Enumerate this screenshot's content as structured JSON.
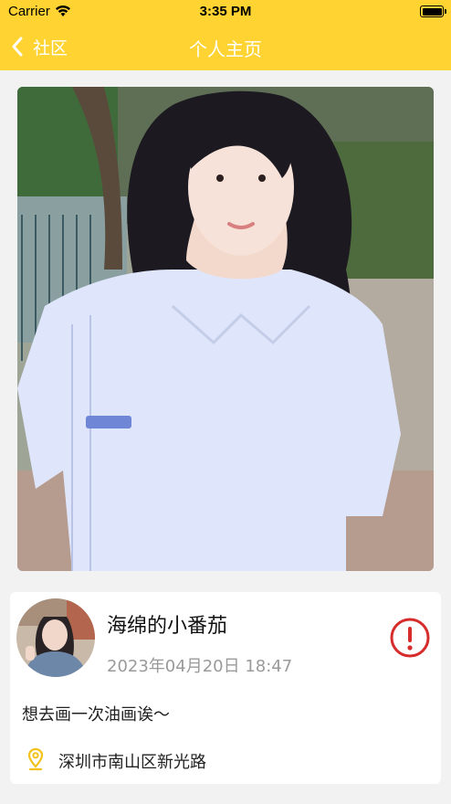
{
  "status_bar": {
    "carrier": "Carrier",
    "time": "3:35 PM"
  },
  "nav": {
    "back_label": "社区",
    "title": "个人主页"
  },
  "colors": {
    "accent": "#fed332",
    "report": "#d62c2c",
    "location_pin": "#f2c21b"
  },
  "post": {
    "username": "海绵的小番茄",
    "datetime": "2023年04月20日  18:47",
    "content": "想去画一次油画诶～",
    "location": "深圳市南山区新光路"
  },
  "icons": {
    "back": "chevron-left-icon",
    "report": "exclamation-circle-icon",
    "location": "map-pin-icon",
    "wifi": "wifi-icon",
    "battery": "battery-icon"
  }
}
